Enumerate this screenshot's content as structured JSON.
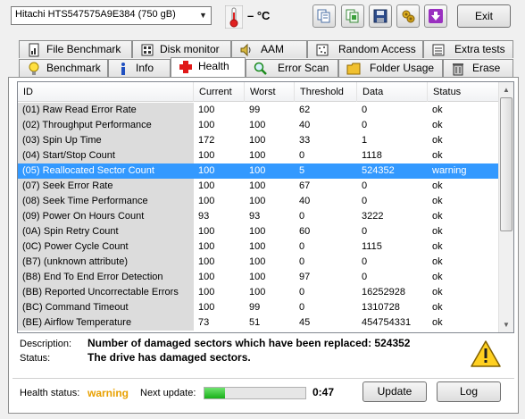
{
  "toolbar": {
    "drive": "Hitachi HTS547575A9E384  (750 gB)",
    "temperature": "– °C",
    "exit_label": "Exit",
    "icons": [
      "copy-icon",
      "copy-all-icon",
      "save-icon",
      "options-icon",
      "minimize-to-tray-icon"
    ]
  },
  "tabs_row1": [
    {
      "label": "File Benchmark",
      "icon": "file-benchmark-icon"
    },
    {
      "label": "Disk monitor",
      "icon": "disk-monitor-icon"
    },
    {
      "label": "AAM",
      "icon": "speaker-icon"
    },
    {
      "label": "Random Access",
      "icon": "random-access-icon"
    },
    {
      "label": "Extra tests",
      "icon": "extra-tests-icon"
    }
  ],
  "tabs_row2": [
    {
      "label": "Benchmark",
      "icon": "lightbulb-icon"
    },
    {
      "label": "Info",
      "icon": "info-icon"
    },
    {
      "label": "Health",
      "icon": "red-cross-icon",
      "active": true
    },
    {
      "label": "Error Scan",
      "icon": "magnifier-icon"
    },
    {
      "label": "Folder Usage",
      "icon": "folder-icon"
    },
    {
      "label": "Erase",
      "icon": "trash-icon"
    }
  ],
  "columns": [
    "ID",
    "Current",
    "Worst",
    "Threshold",
    "Data",
    "Status"
  ],
  "rows": [
    [
      "(01) Raw Read Error Rate",
      "100",
      "99",
      "62",
      "0",
      "ok"
    ],
    [
      "(02) Throughput Performance",
      "100",
      "100",
      "40",
      "0",
      "ok"
    ],
    [
      "(03) Spin Up Time",
      "172",
      "100",
      "33",
      "1",
      "ok"
    ],
    [
      "(04) Start/Stop Count",
      "100",
      "100",
      "0",
      "1118",
      "ok"
    ],
    [
      "(05) Reallocated Sector Count",
      "100",
      "100",
      "5",
      "524352",
      "warning"
    ],
    [
      "(07) Seek Error Rate",
      "100",
      "100",
      "67",
      "0",
      "ok"
    ],
    [
      "(08) Seek Time Performance",
      "100",
      "100",
      "40",
      "0",
      "ok"
    ],
    [
      "(09) Power On Hours Count",
      "93",
      "93",
      "0",
      "3222",
      "ok"
    ],
    [
      "(0A) Spin Retry Count",
      "100",
      "100",
      "60",
      "0",
      "ok"
    ],
    [
      "(0C) Power Cycle Count",
      "100",
      "100",
      "0",
      "1115",
      "ok"
    ],
    [
      "(B7) (unknown attribute)",
      "100",
      "100",
      "0",
      "0",
      "ok"
    ],
    [
      "(B8) End To End Error Detection",
      "100",
      "100",
      "97",
      "0",
      "ok"
    ],
    [
      "(BB) Reported Uncorrectable Errors",
      "100",
      "100",
      "0",
      "16252928",
      "ok"
    ],
    [
      "(BC) Command Timeout",
      "100",
      "99",
      "0",
      "1310728",
      "ok"
    ],
    [
      "(BE) Airflow Temperature",
      "73",
      "51",
      "45",
      "454754331",
      "ok"
    ]
  ],
  "selected_row": 4,
  "details": {
    "description_label": "Description:",
    "description_value": "Number of damaged sectors which have been replaced: 524352",
    "status_label": "Status:",
    "status_value": "The drive has damaged sectors."
  },
  "footer": {
    "health_label": "Health status:",
    "health_value": "warning",
    "next_update_label": "Next update:",
    "next_update_progress": 0.2,
    "countdown": "0:47",
    "update_label": "Update",
    "log_label": "Log"
  }
}
